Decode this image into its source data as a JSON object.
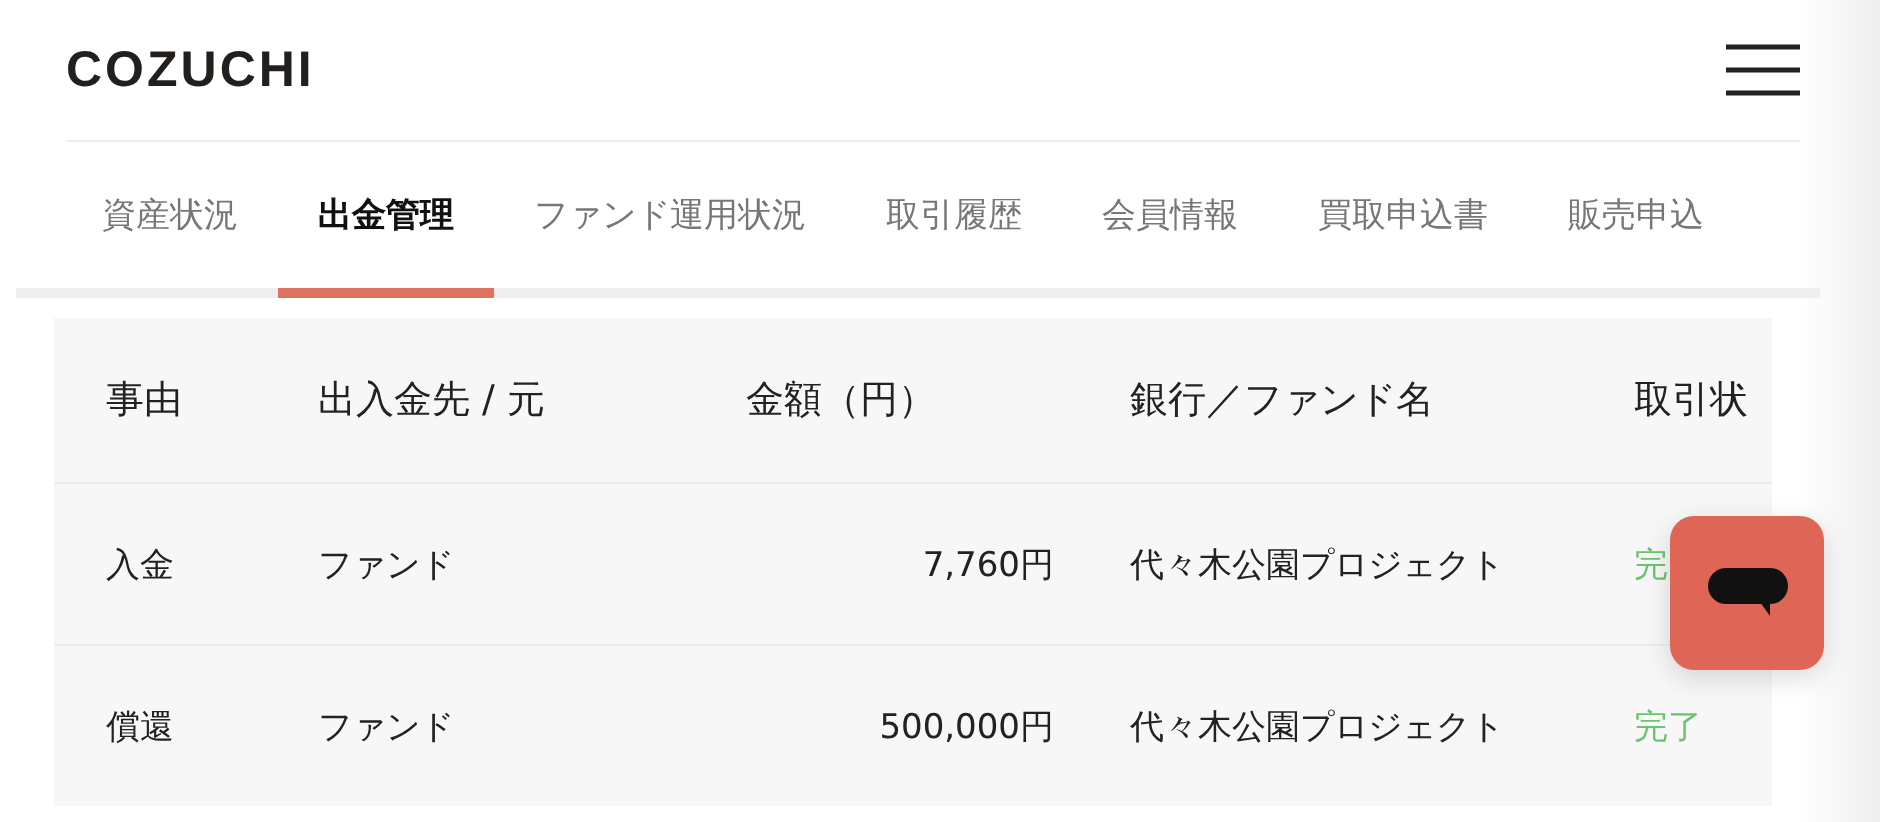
{
  "header": {
    "logo": "COZUCHI"
  },
  "tabs": [
    {
      "label": "資産状況",
      "selected": false
    },
    {
      "label": "出金管理",
      "selected": true
    },
    {
      "label": "ファンド運用状況",
      "selected": false
    },
    {
      "label": "取引履歴",
      "selected": false
    },
    {
      "label": "会員情報",
      "selected": false
    },
    {
      "label": "買取申込書",
      "selected": false
    },
    {
      "label": "販売申込",
      "selected": false
    }
  ],
  "table": {
    "columns": [
      "事由",
      "出入金先 / 元",
      "金額（円）",
      "銀行／ファンド名",
      "取引状"
    ],
    "rows": [
      {
        "reason": "入金",
        "party": "ファンド",
        "amount": "7,760円",
        "name": "代々木公園プロジェクト",
        "status": "完"
      },
      {
        "reason": "償還",
        "party": "ファンド",
        "amount": "500,000円",
        "name": "代々木公園プロジェクト",
        "status": "完了"
      }
    ]
  }
}
